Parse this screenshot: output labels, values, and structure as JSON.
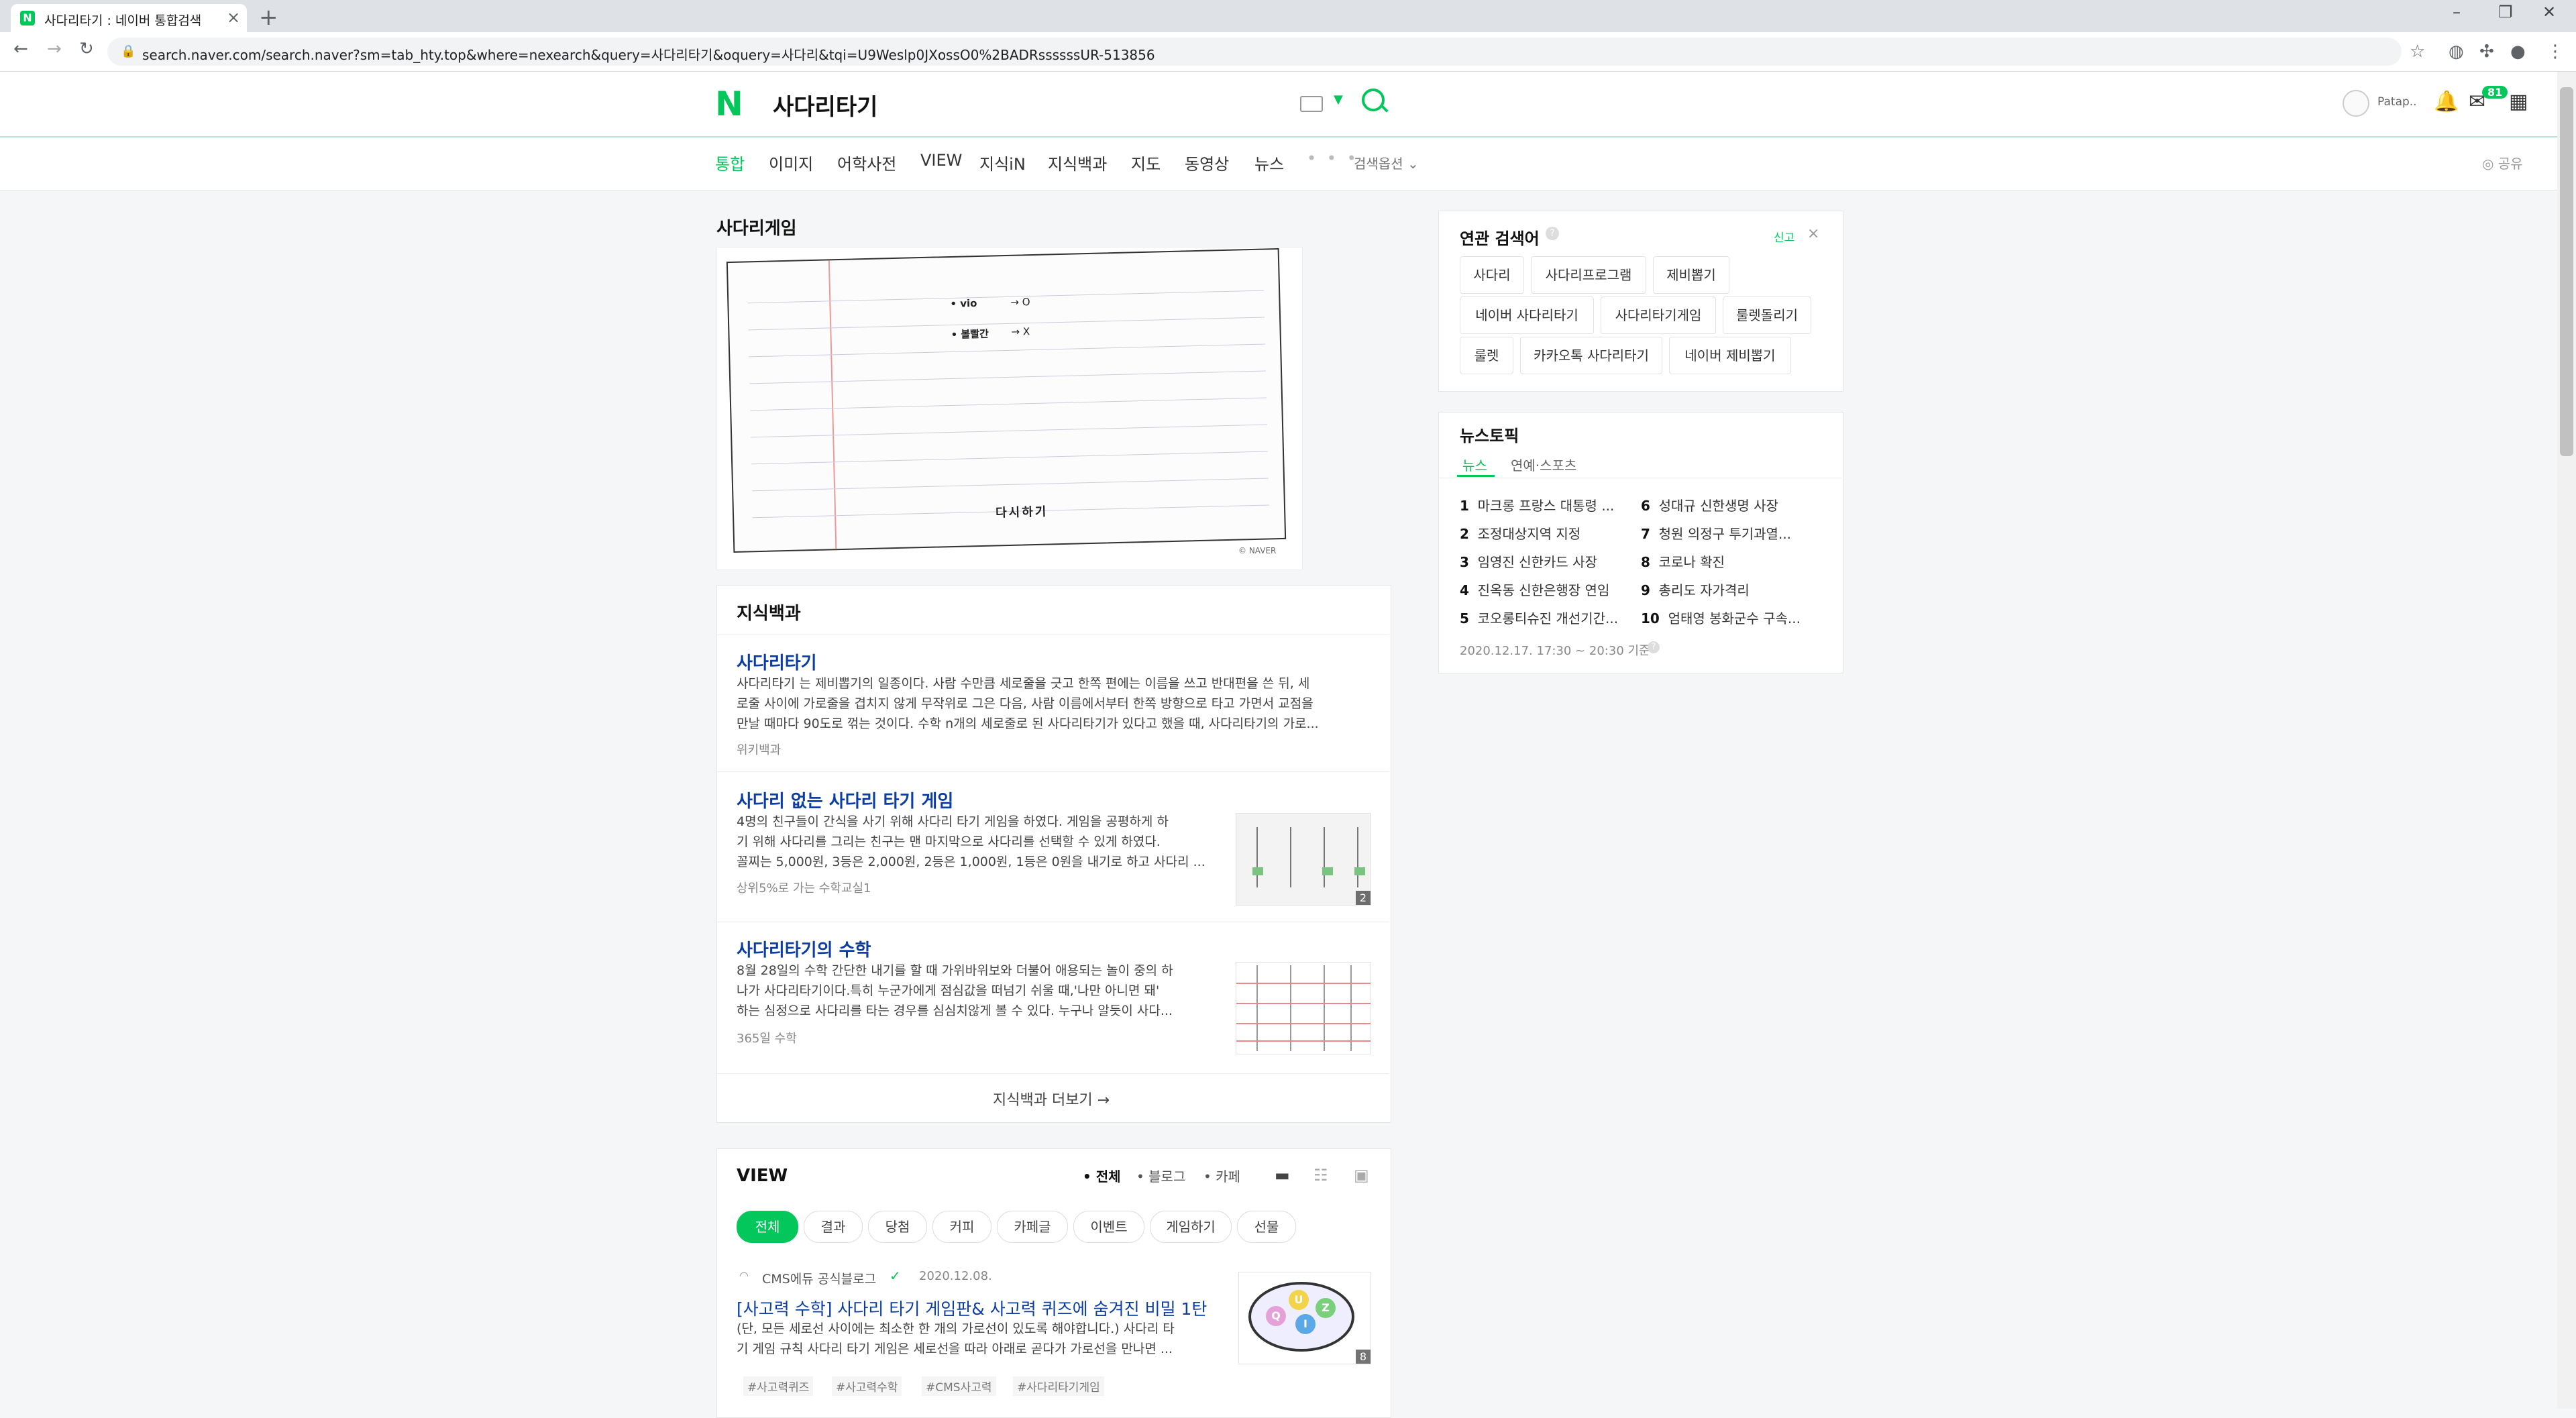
{
  "browser": {
    "tab_title": "사다리타기 : 네이버 통합검색",
    "url": "search.naver.com/search.naver?sm=tab_hty.top&where=nexearch&query=사다리타기&oquery=사다리&tqi=U9Weslp0JXossO0%2BADRssssssUR-513856"
  },
  "header": {
    "logo": "N",
    "query": "사다리타기",
    "user": "Patap..",
    "mail_badge": "81"
  },
  "nav": {
    "items": [
      "통합",
      "이미지",
      "어학사전",
      "VIEW",
      "지식iN",
      "지식백과",
      "지도",
      "동영상",
      "뉴스"
    ],
    "more": "• • •",
    "options": "검색옵션",
    "share": "공유"
  },
  "image_section": {
    "title": "사다리게임",
    "line1_label": "• vio",
    "line1_value": "→ O",
    "line2_label": "• 볼빨간",
    "line2_value": "→ X",
    "logo_text": "다시하기",
    "watermark": "© NAVER"
  },
  "encyclopedia": {
    "title": "지식백과",
    "items": [
      {
        "title": "사다리타기",
        "snippet1": "사다리타기 는 제비뽑기의 일종이다. 사람 수만큼 세로줄을 긋고 한쪽 편에는 이름을 쓰고 반대편을 쓴 뒤, 세",
        "snippet2": "로줄 사이에 가로줄을 겹치지 않게 무작위로 그은 다음, 사람 이름에서부터 한쪽 방향으로 타고 가면서 교점을",
        "snippet3": "만날 때마다 90도로 꺾는 것이다. 수학 n개의 세로줄로 된 사다리타기가 있다고 했을 때, 사다리타기의 가로...",
        "source": "위키백과"
      },
      {
        "title": "사다리 없는 사다리 타기 게임",
        "snippet1": "4명의 친구들이 간식을 사기 위해 사다리 타기 게임을 하였다. 게임을 공평하게 하",
        "snippet2": "기 위해 사다리를 그리는 친구는 맨 마지막으로 사다리를 선택할 수 있게 하였다.",
        "snippet3": "꼴찌는 5,000원, 3등은 2,000원, 2등은 1,000원, 1등은 0원을 내기로 하고 사다리 ...",
        "snippet4": "",
        "source": "상위5%로 가는 수학교실1",
        "thumb_count": "2"
      },
      {
        "title": "사다리타기의 수학",
        "snippet1": "8월 28일의 수학 간단한 내기를 할 때 가위바위보와 더불어 애용되는 놀이 중의 하",
        "snippet2": "나가 사다리타기이다.특히 누군가에게 점심값을 떠넘기 쉬울 때,'나만 아니면 돼'",
        "snippet3": "하는 심정으로 사다리를 타는 경우를 심심치않게 볼 수 있다. 누구나 알듯이 사다...",
        "source": "365일 수학"
      }
    ],
    "more": "지식백과 더보기 →"
  },
  "view": {
    "title": "VIEW",
    "filters": [
      "• 전체",
      "• 블로그",
      "• 카페"
    ],
    "chips": [
      "전체",
      "결과",
      "당첨",
      "커피",
      "카페글",
      "이벤트",
      "게임하기",
      "선물"
    ],
    "post": {
      "author": "CMS에듀 공식블로그",
      "date": "2020.12.08.",
      "title": "[사고력 수학] 사다리 타기 게임판& 사고력 퀴즈에 숨겨진 비밀 1탄",
      "snippet1": "(단, 모든 세로선 사이에는 최소한 한 개의 가로선이 있도록 해야합니다.) 사다리 타",
      "snippet2": "기 게임 규칙 사다리 타기 게임은 세로선을 따라 아래로 곧다가 가로선을 만나면 ...",
      "tags": [
        "#사고력퀴즈",
        "#사고력수학",
        "#CMS사고력",
        "#사다리타기게임"
      ],
      "thumb_count": "8",
      "thumb_letters": [
        "Q",
        "U",
        "I",
        "Z"
      ]
    }
  },
  "related": {
    "title": "연관 검색어",
    "report": "신고",
    "close": "×",
    "items": [
      [
        "사다리",
        "사다리프로그램",
        "제비뽑기"
      ],
      [
        "네이버 사다리타기",
        "사다리타기게임",
        "룰렛돌리기"
      ],
      [
        "룰렛",
        "카카오톡 사다리타기",
        "네이버 제비뽑기"
      ]
    ]
  },
  "news_topic": {
    "title": "뉴스토픽",
    "tabs": [
      "뉴스",
      "연예·스포츠"
    ],
    "left": [
      [
        "1",
        "마크롱 프랑스 대통령 ..."
      ],
      [
        "2",
        "조정대상지역 지정"
      ],
      [
        "3",
        "임영진 신한카드 사장"
      ],
      [
        "4",
        "진옥동 신한은행장 연임"
      ],
      [
        "5",
        "코오롱티슈진 개선기간..."
      ]
    ],
    "right": [
      [
        "6",
        "성대규 신한생명 사장"
      ],
      [
        "7",
        "청원 의정구 투기과열..."
      ],
      [
        "8",
        "코로나 확진"
      ],
      [
        "9",
        "총리도 자가격리"
      ],
      [
        "10",
        "엄태영 봉화군수 구속..."
      ]
    ],
    "timestamp": "2020.12.17. 17:30 ~ 20:30 기준"
  },
  "colors": {
    "accent": "#03c75a",
    "link": "#0c3da0"
  }
}
